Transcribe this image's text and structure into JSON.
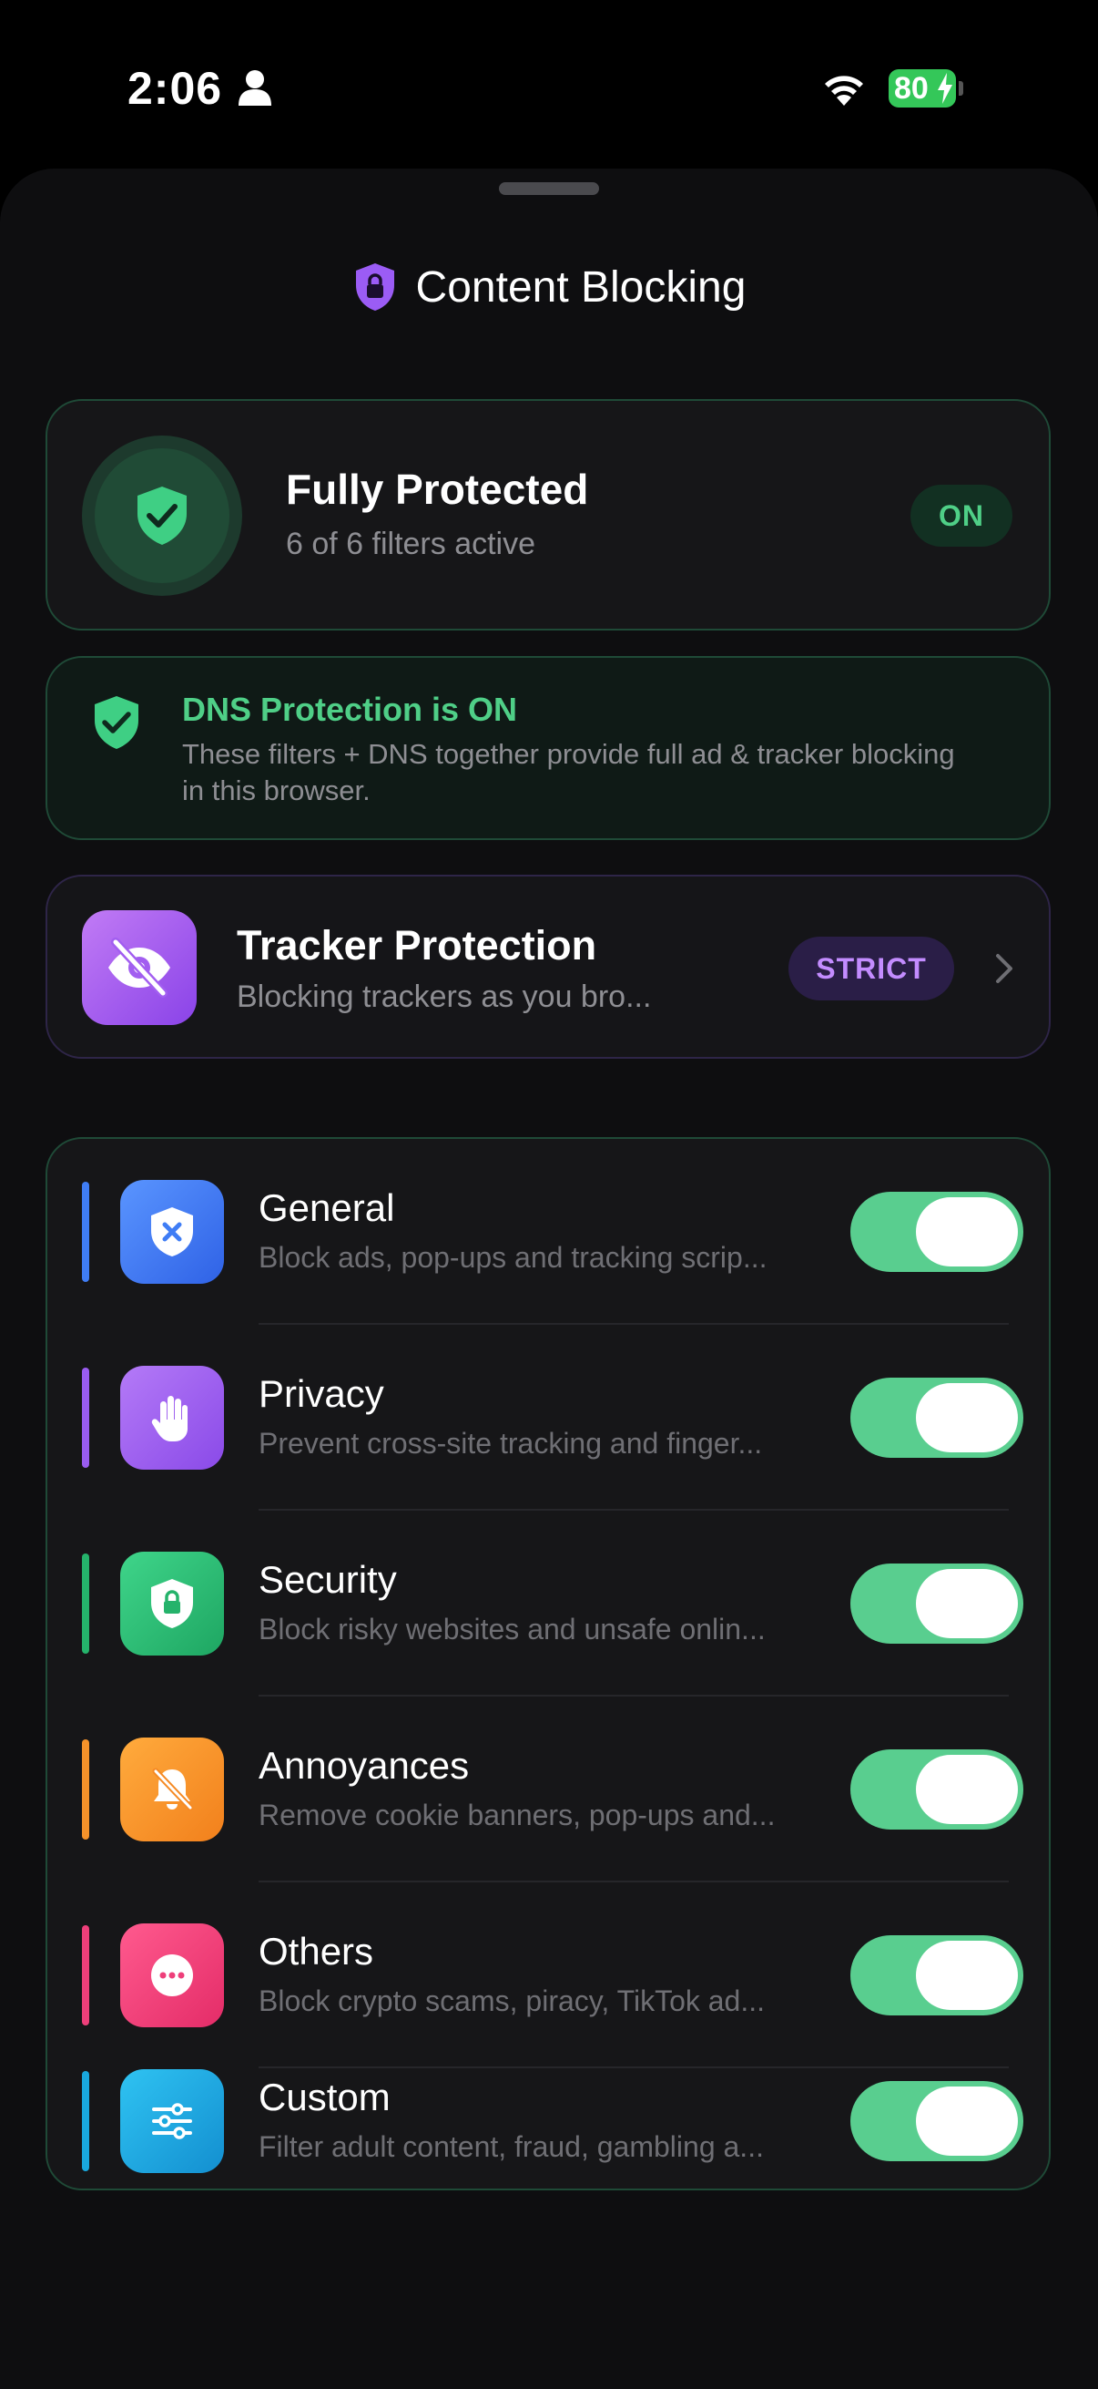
{
  "status_bar": {
    "time": "2:06",
    "battery": "80"
  },
  "header": {
    "title": "Content Blocking",
    "icon": "shield-lock-icon"
  },
  "protection_status": {
    "title": "Fully Protected",
    "subtitle": "6 of 6 filters active",
    "badge": "ON"
  },
  "dns": {
    "title": "DNS Protection is ON",
    "body": "These filters + DNS together provide full ad & tracker blocking in this browser."
  },
  "tracker": {
    "title": "Tracker Protection",
    "subtitle": "Blocking trackers as you bro...",
    "badge": "STRICT"
  },
  "filters": [
    {
      "name": "General",
      "description": "Block ads, pop-ups and tracking scrip...",
      "enabled": true,
      "color": "#3f7df5",
      "icon": "shield-x-icon"
    },
    {
      "name": "Privacy",
      "description": "Prevent cross-site tracking and finger...",
      "enabled": true,
      "color": "#9a5cf0",
      "icon": "hand-icon"
    },
    {
      "name": "Security",
      "description": "Block risky websites and unsafe onlin...",
      "enabled": true,
      "color": "#25b36b",
      "icon": "shield-lock-icon"
    },
    {
      "name": "Annoyances",
      "description": "Remove cookie banners, pop-ups and...",
      "enabled": true,
      "color": "#f5922a",
      "icon": "bell-slash-icon"
    },
    {
      "name": "Others",
      "description": "Block crypto scams, piracy, TikTok ad...",
      "enabled": true,
      "color": "#ee3f7a",
      "icon": "ellipsis-icon"
    },
    {
      "name": "Custom",
      "description": "Filter adult content, fraud, gambling a...",
      "enabled": true,
      "color": "#19a8de",
      "icon": "sliders-icon"
    }
  ]
}
